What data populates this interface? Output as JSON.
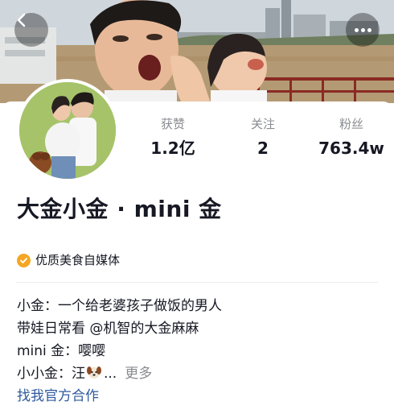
{
  "header": {
    "back_icon": "chevron-left-icon",
    "more_icon": "more-dots-icon"
  },
  "profile": {
    "name": "大金小金 · mini 金",
    "badge_text": "优质美食自媒体",
    "badge_color": "#f5a623"
  },
  "stats": [
    {
      "label": "获赞",
      "value": "1.2亿"
    },
    {
      "label": "关注",
      "value": "2"
    },
    {
      "label": "粉丝",
      "value": "763.4w"
    }
  ],
  "bio": {
    "line1": "小金：一个给老婆孩子做饭的男人",
    "line2": "带娃日常看 @机智的大金麻麻",
    "line3": "mini 金：嘤嘤",
    "line4_prefix": "小小金：汪",
    "line4_suffix": "...",
    "more_label": "更多",
    "emoji": "dog-face-icon"
  },
  "collab_link": "找我官方合作",
  "colors": {
    "link": "#2f5a9e",
    "secondary_text": "#8a8b91",
    "primary_text": "#161823"
  }
}
